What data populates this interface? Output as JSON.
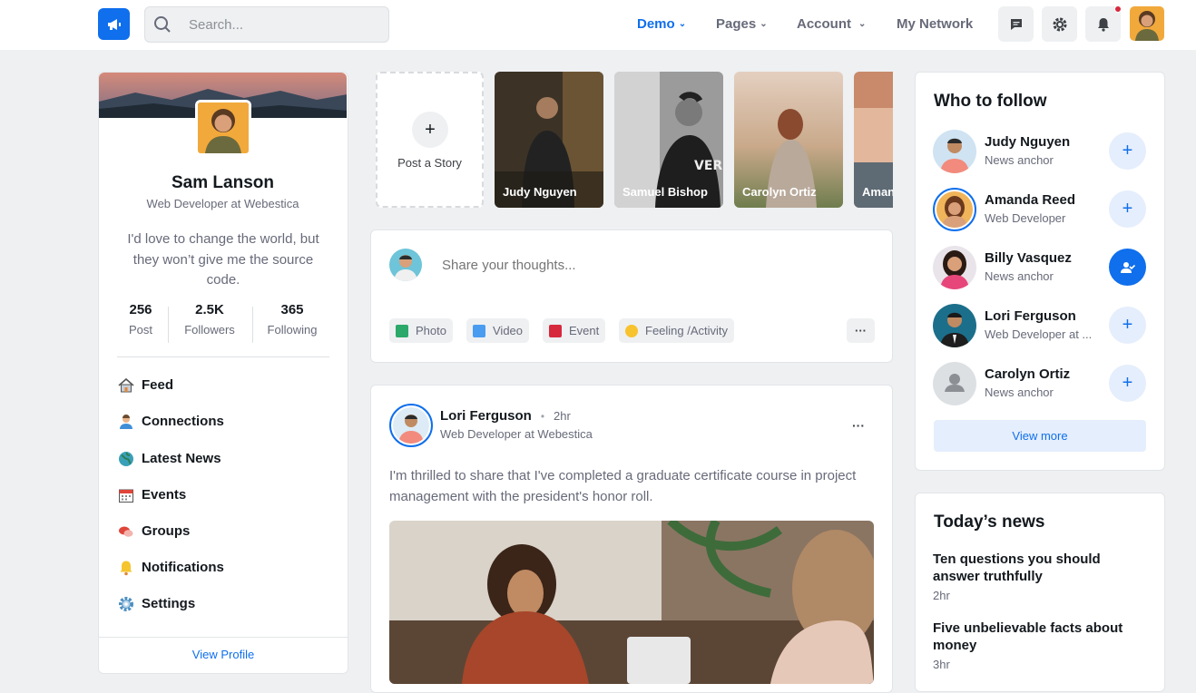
{
  "nav": {
    "search_placeholder": "Search...",
    "menu": [
      {
        "label": "Demo",
        "active": true
      },
      {
        "label": "Pages"
      },
      {
        "label": "Account"
      },
      {
        "label": "My Network"
      }
    ],
    "icons": [
      "chat-icon",
      "gear-icon",
      "bell-icon"
    ],
    "accent": "#0f6fec"
  },
  "profile": {
    "name": "Sam Lanson",
    "title": "Web Developer at Webestica",
    "bio": "I'd love to change the world, but they won’t give me the source code.",
    "stats": [
      {
        "value": "256",
        "label": "Post"
      },
      {
        "value": "2.5K",
        "label": "Followers"
      },
      {
        "value": "365",
        "label": "Following"
      }
    ],
    "menu": [
      {
        "label": "Feed",
        "icon": "home-icon"
      },
      {
        "label": "Connections",
        "icon": "person-icon"
      },
      {
        "label": "Latest News",
        "icon": "globe-icon"
      },
      {
        "label": "Events",
        "icon": "calendar-icon"
      },
      {
        "label": "Groups",
        "icon": "chat-bubbles-icon"
      },
      {
        "label": "Notifications",
        "icon": "bell-icon"
      },
      {
        "label": "Settings",
        "icon": "gear-icon"
      }
    ],
    "view_profile": "View Profile"
  },
  "stories": {
    "post_label": "Post a Story",
    "items": [
      "Judy Nguyen",
      "Samuel Bishop",
      "Carolyn Ortiz",
      "Amanda"
    ]
  },
  "composer": {
    "placeholder": "Share your thoughts...",
    "actions": [
      "Photo",
      "Video",
      "Event",
      "Feeling /Activity"
    ]
  },
  "post": {
    "author": "Lori Ferguson",
    "time": "2hr",
    "subtitle": "Web Developer at Webestica",
    "body": "I'm thrilled to share that I've completed a graduate certificate course in project management with the president's honor roll."
  },
  "follow": {
    "title": "Who to follow",
    "people": [
      {
        "name": "Judy Nguyen",
        "role": "News anchor",
        "following": false
      },
      {
        "name": "Amanda Reed",
        "role": "Web Developer",
        "following": false
      },
      {
        "name": "Billy Vasquez",
        "role": "News anchor",
        "following": true
      },
      {
        "name": "Lori Ferguson",
        "role": "Web Developer at ...",
        "following": false
      },
      {
        "name": "Carolyn Ortiz",
        "role": "News anchor",
        "following": false
      }
    ],
    "view_more": "View more"
  },
  "news": {
    "title": "Today’s news",
    "items": [
      {
        "headline": "Ten questions you should answer truthfully",
        "time": "2hr"
      },
      {
        "headline": "Five unbelievable facts about money",
        "time": "3hr"
      }
    ]
  }
}
